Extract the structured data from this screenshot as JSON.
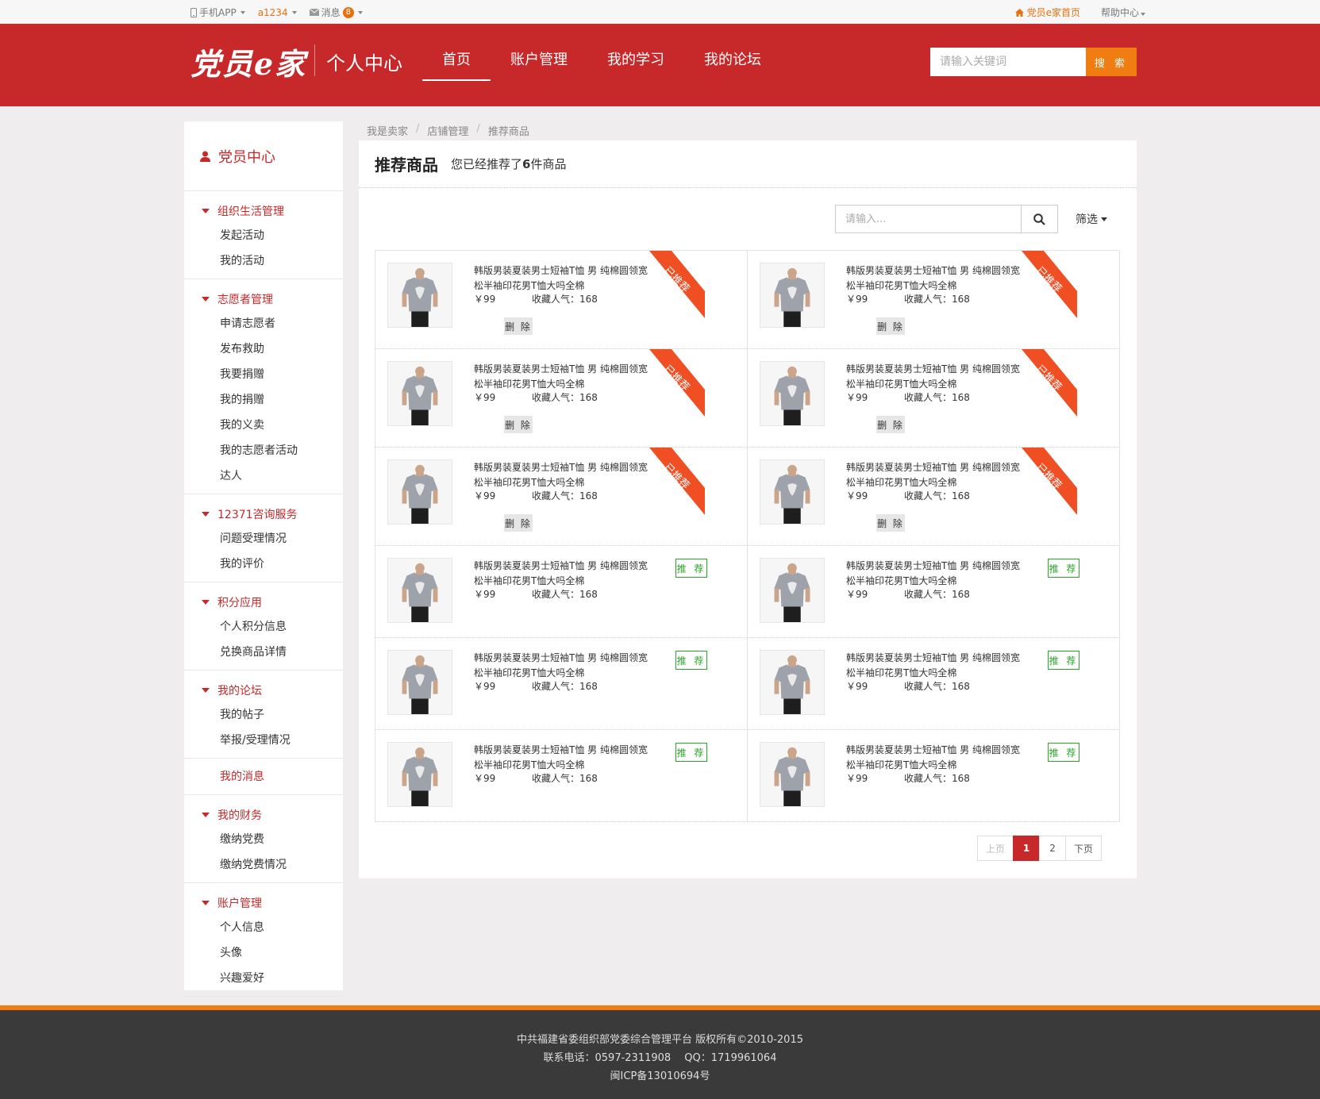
{
  "topbar": {
    "app_label": "手机APP",
    "username": "a1234",
    "messages_label": "消息",
    "messages_count": "8",
    "home_link": "党员e家首页",
    "help_link": "帮助中心"
  },
  "header": {
    "logo": "党员e家",
    "subtitle": "个人中心",
    "nav": [
      "首页",
      "账户管理",
      "我的学习",
      "我的论坛"
    ],
    "search_placeholder": "请输入关键词",
    "search_button": "搜 索"
  },
  "sidebar": {
    "title": "党员中心",
    "groups": [
      {
        "title": "组织生活管理",
        "items": [
          "发起活动",
          "我的活动"
        ]
      },
      {
        "title": "志愿者管理",
        "items": [
          "申请志愿者",
          "发布救助",
          "我要捐赠",
          "我的捐赠",
          "我的义卖",
          "我的志愿者活动",
          "达人"
        ]
      },
      {
        "title": "12371咨询服务",
        "items": [
          "问题受理情况",
          "我的评价"
        ]
      },
      {
        "title": "积分应用",
        "items": [
          "个人积分信息",
          "兑换商品详情"
        ]
      },
      {
        "title": "我的论坛",
        "items": [
          "我的帖子",
          "举报/受理情况"
        ]
      }
    ],
    "messages": "我的消息",
    "groups2": [
      {
        "title": "我的财务",
        "items": [
          "缴纳党费",
          "缴纳党费情况"
        ]
      },
      {
        "title": "账户管理",
        "items": [
          "个人信息",
          "头像",
          "兴趣爱好"
        ]
      }
    ]
  },
  "breadcrumb": [
    "我是卖家",
    "店铺管理",
    "推荐商品"
  ],
  "main": {
    "title": "推荐商品",
    "desc_prefix": "您已经推荐了",
    "desc_count": "6",
    "desc_suffix": "件商品",
    "filter_placeholder": "请输入...",
    "filter_select": "筛选"
  },
  "product": {
    "name": "韩版男装夏装男士短袖T恤 男 纯棉圆领宽松半袖印花男T恤大吗全棉",
    "price": "￥99",
    "popularity": "收藏人气：168",
    "delete_label": "删 除",
    "recommended_label": "已推荐",
    "recommend_label": "推 荐"
  },
  "pagination": {
    "prev": "上页",
    "pages": [
      "1",
      "2"
    ],
    "next": "下页"
  },
  "footer": {
    "line1": "中共福建省委组织部党委综合管理平台 版权所有©2010-2015",
    "line2": "联系电话：0597-2311908　 QQ：1719961064",
    "line3": "闽ICP备13010694号"
  },
  "colors": {
    "brand_red": "#c7282a",
    "accent_orange": "#f07d12",
    "ribbon": "#f04e23",
    "recommend_green": "#2aa52a"
  }
}
